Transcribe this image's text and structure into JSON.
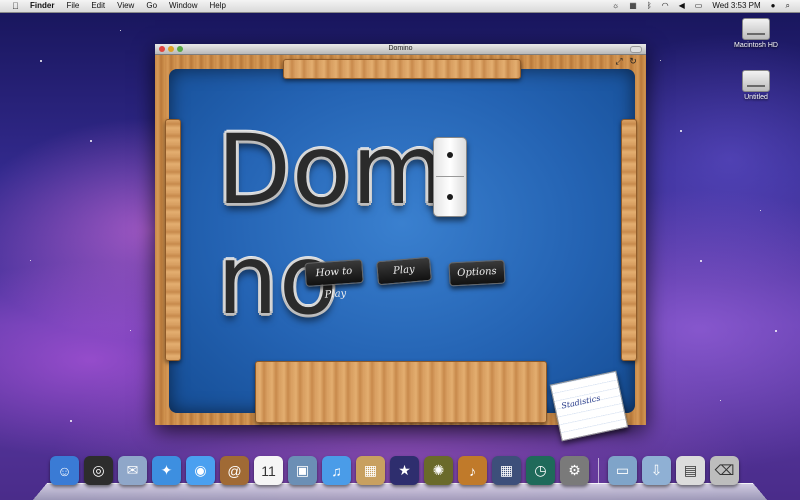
{
  "menubar": {
    "app": "Finder",
    "menus": [
      "File",
      "Edit",
      "View",
      "Go",
      "Window",
      "Help"
    ],
    "clock": "Wed 3:53 PM"
  },
  "desktop": {
    "icons": [
      {
        "label": "Macintosh HD"
      },
      {
        "label": "Untitled"
      }
    ]
  },
  "window": {
    "title": "Domino"
  },
  "game": {
    "logo_text": "Dom no",
    "buttons": {
      "how_to_play": "How to Play",
      "play": "Play",
      "options": "Options"
    },
    "notepad": "Stadistics"
  },
  "dock": {
    "icons": [
      {
        "name": "finder-icon",
        "color": "#3a7bd5",
        "glyph": "☺"
      },
      {
        "name": "dashboard-icon",
        "color": "#2d2d2d",
        "glyph": "◎"
      },
      {
        "name": "mail-icon",
        "color": "#8fa7c9",
        "glyph": "✉"
      },
      {
        "name": "safari-icon",
        "color": "#3d8fe0",
        "glyph": "✦"
      },
      {
        "name": "ichat-icon",
        "color": "#4aa0f0",
        "glyph": "◉"
      },
      {
        "name": "address-book-icon",
        "color": "#a06a35",
        "glyph": "@"
      },
      {
        "name": "ical-icon",
        "color": "#f5f5f5",
        "glyph": "11"
      },
      {
        "name": "preview-icon",
        "color": "#6b8fb5",
        "glyph": "▣"
      },
      {
        "name": "itunes-icon",
        "color": "#4a9ce8",
        "glyph": "♫"
      },
      {
        "name": "iphoto-icon",
        "color": "#c8a060",
        "glyph": "▦"
      },
      {
        "name": "imovie-icon",
        "color": "#2e2e6e",
        "glyph": "★"
      },
      {
        "name": "idvd-icon",
        "color": "#6a6a2a",
        "glyph": "✺"
      },
      {
        "name": "garageband-icon",
        "color": "#c07a2a",
        "glyph": "♪"
      },
      {
        "name": "spaces-icon",
        "color": "#3d4f7a",
        "glyph": "▦"
      },
      {
        "name": "time-machine-icon",
        "color": "#1f6a5a",
        "glyph": "◷"
      },
      {
        "name": "system-preferences-icon",
        "color": "#7a7a7a",
        "glyph": "⚙"
      },
      {
        "name": "applications-folder-icon",
        "color": "#7fa4c9",
        "glyph": "▭"
      },
      {
        "name": "downloads-folder-icon",
        "color": "#8fb0d4",
        "glyph": "⇩"
      },
      {
        "name": "documents-stack-icon",
        "color": "#dcdcdc",
        "glyph": "▤"
      },
      {
        "name": "trash-icon",
        "color": "#bdbdbd",
        "glyph": "⌫"
      }
    ]
  }
}
